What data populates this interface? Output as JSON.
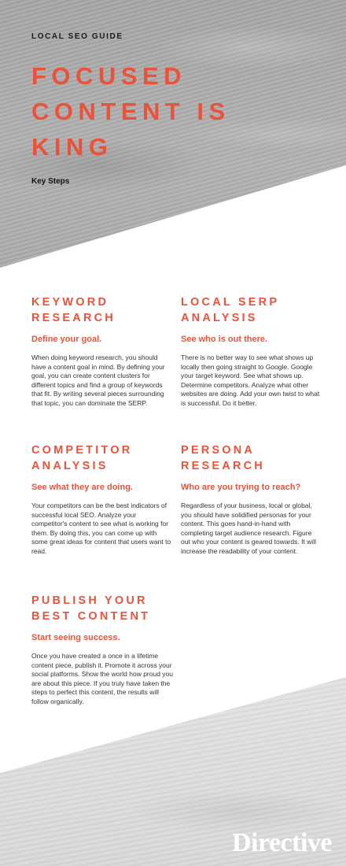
{
  "header": {
    "kicker": "LOCAL SEO GUIDE",
    "title_lines": [
      "FOCUSED",
      "CONTENT IS",
      "KING"
    ],
    "subtitle": "Key Steps"
  },
  "sections": [
    {
      "title_lines": [
        "KEYWORD",
        "RESEARCH"
      ],
      "subtitle": "Define your goal.",
      "body": "When doing keyword research, you should have a content goal in mind. By defining your goal, you can create content clusters for different topics and find a group of keywords that fit. By writing several pieces surrounding that topic, you can dominate the SERP."
    },
    {
      "title_lines": [
        "LOCAL SERP",
        "ANALYSIS"
      ],
      "subtitle": "See who is out there.",
      "body": "There is no better way to see what shows up locally then going straight to Google. Google your target keyword. See what shows up. Determine competitors. Analyze what other websites are doing. Add your own twist to what is successful. Do it better."
    },
    {
      "title_lines": [
        "COMPETITOR",
        "ANALYSIS"
      ],
      "subtitle": "See what they are doing.",
      "body": "Your competitors can be the best indicators of successful local SEO. Analyze your competitor's content to see what is working for them. By doing this, you can come up with some great ideas for content that users want to read."
    },
    {
      "title_lines": [
        "PERSONA",
        "RESEARCH"
      ],
      "subtitle": "Who are you trying to reach?",
      "body": "Regardless of your business, local or global, you should have solidified personas for your content. This goes hand-in-hand with completing target audience research. Figure out who your content is geared towards. It will increase the readability of your content."
    },
    {
      "title_lines": [
        "PUBLISH YOUR",
        "BEST CONTENT"
      ],
      "subtitle": "Start seeing success.",
      "body": "Once you have created a once in a lifetime content piece, publish it. Promote it across your social platforms. Show the world how proud you are about this piece. If you truly have taken the steps to perfect this content, the results will follow organically."
    }
  ],
  "brand": {
    "logo_text": "Directive",
    "accent_color": "#e9533c"
  }
}
